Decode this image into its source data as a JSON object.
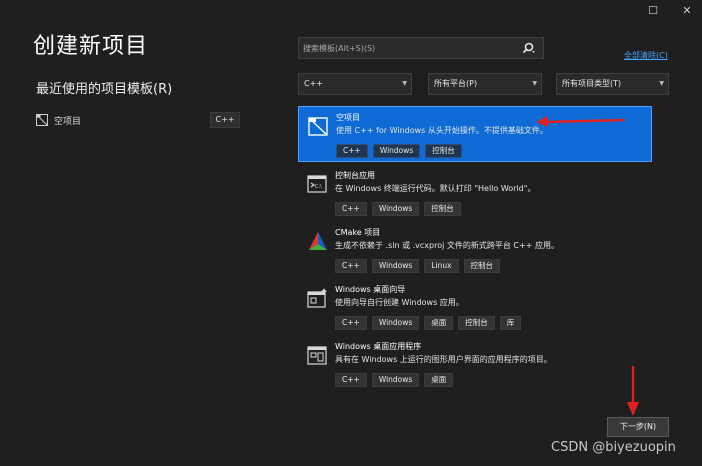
{
  "window": {
    "restore_icon": "restore-icon",
    "close_icon": "close-icon",
    "restore_glyph": "☐",
    "close_glyph": "✕"
  },
  "title": "创建新项目",
  "recent": {
    "heading": "最近使用的项目模板(R)",
    "items": [
      {
        "label": "空项目",
        "tag": "C++",
        "icon": "empty-project-icon"
      }
    ]
  },
  "search": {
    "placeholder": "搜索模板(Alt+S)(S)",
    "value": "",
    "icon": "search-icon"
  },
  "clear_all": "全部清除(C)",
  "filters": {
    "language": "C++",
    "platform": "所有平台(P)",
    "project_type": "所有项目类型(T)"
  },
  "templates": [
    {
      "name": "空项目",
      "desc": "使用 C++ for Windows 从头开始操作。不提供基础文件。",
      "tags": [
        "C++",
        "Windows",
        "控制台"
      ],
      "selected": true,
      "icon": "empty-project-icon"
    },
    {
      "name": "控制台应用",
      "desc": "在 Windows 终端运行代码。默认打印 \"Hello World\"。",
      "tags": [
        "C++",
        "Windows",
        "控制台"
      ],
      "selected": false,
      "icon": "console-app-icon"
    },
    {
      "name": "CMake 项目",
      "desc": "生成不依赖于 .sln 或 .vcxproj 文件的新式跨平台 C++ 应用。",
      "tags": [
        "C++",
        "Windows",
        "Linux",
        "控制台"
      ],
      "selected": false,
      "icon": "cmake-icon"
    },
    {
      "name": "Windows 桌面向导",
      "desc": "使用向导自行创建 Windows 应用。",
      "tags": [
        "C++",
        "Windows",
        "桌面",
        "控制台",
        "库"
      ],
      "selected": false,
      "icon": "desktop-wizard-icon"
    },
    {
      "name": "Windows 桌面应用程序",
      "desc": "具有在 Windows 上运行的图形用户界面的应用程序的项目。",
      "tags": [
        "C++",
        "Windows",
        "桌面"
      ],
      "selected": false,
      "icon": "desktop-app-icon"
    }
  ],
  "next_button": "下一步(N)",
  "watermark": "CSDN @biyezuopin",
  "colors": {
    "accent": "#0e6bd6",
    "background": "#1f1f1f",
    "arrow": "#e02020",
    "link": "#4aa3ff"
  }
}
